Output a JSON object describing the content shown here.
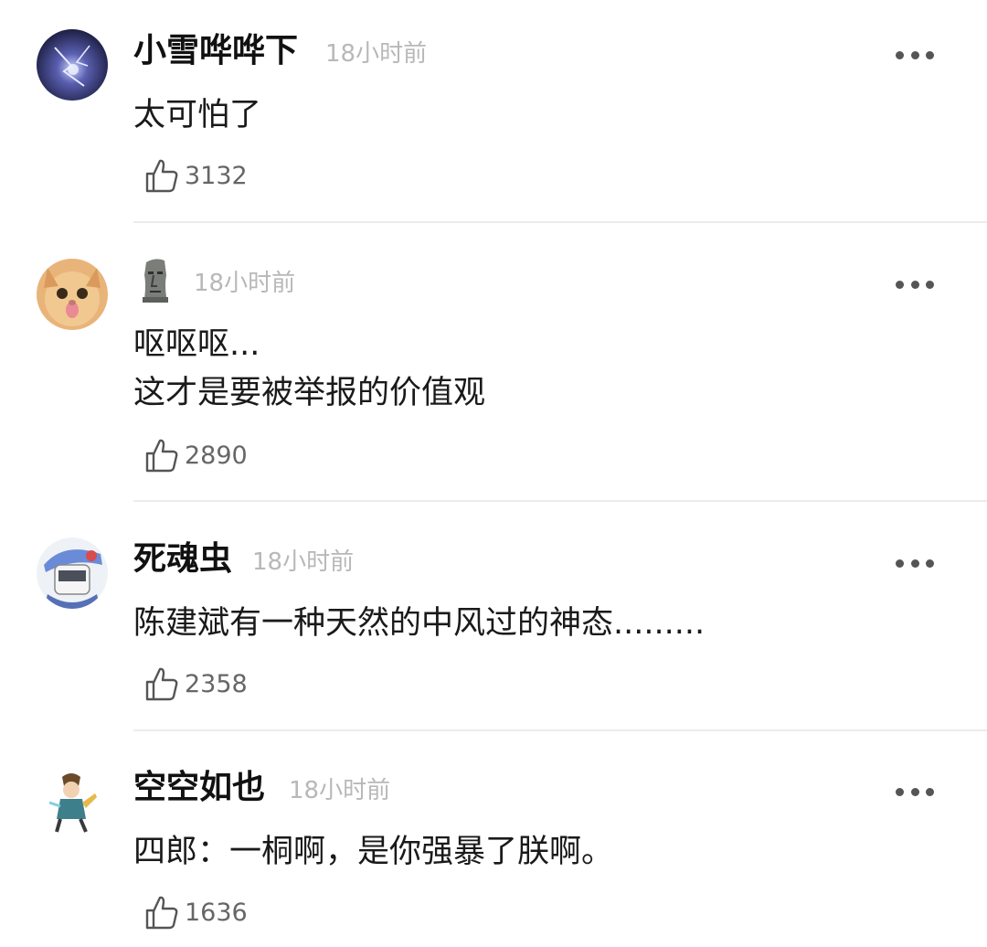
{
  "comments": [
    {
      "user": "小雪哗哗下",
      "time": "18小时前",
      "lines": [
        "太可怕了"
      ],
      "likes": "3132",
      "avatar_icon": "galaxy-avatar"
    },
    {
      "user": "",
      "user_emoji": "moai-emoji",
      "time": "18小时前",
      "lines": [
        "呕呕呕...",
        "这才是要被举报的价值观"
      ],
      "likes": "2890",
      "avatar_icon": "cat-avatar"
    },
    {
      "user": "死魂虫",
      "time": "18小时前",
      "lines": [
        "陈建斌有一种天然的中风过的神态........."
      ],
      "likes": "2358",
      "avatar_icon": "anime-avatar"
    },
    {
      "user": "空空如也",
      "time": "18小时前",
      "lines": [
        "四郎：一桐啊，是你强暴了朕啊。"
      ],
      "likes": "1636",
      "avatar_icon": "game-character-avatar"
    }
  ],
  "icons": {
    "like": "thumbs-up-icon",
    "more": "more-dots-icon"
  },
  "colors": {
    "username": "#111111",
    "timestamp": "#b8b8b8",
    "text": "#1a1a1a",
    "likes": "#666666",
    "divider": "#ececec"
  }
}
